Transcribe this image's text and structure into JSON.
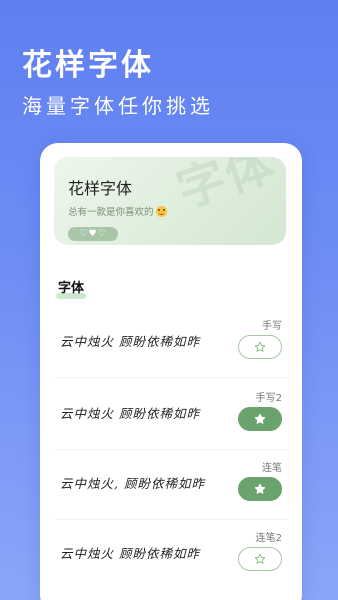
{
  "header": {
    "title": "花样字体",
    "subtitle": "海量字体任你挑选"
  },
  "banner": {
    "title": "花样字体",
    "description": "总有一款是你喜欢的",
    "pill": "♡♥♡",
    "watermark": "字体"
  },
  "section": {
    "tab_label": "字体"
  },
  "fonts": [
    {
      "sample": "云中烛火 顾盼依稀如昨",
      "name": "手写",
      "favorited": false
    },
    {
      "sample": "云中烛火 顾盼依稀如昨",
      "name": "手写2",
      "favorited": true
    },
    {
      "sample": "云中烛火, 顾盼依稀如昨",
      "name": "连笔",
      "favorited": true
    },
    {
      "sample": "云中烛火 顾盼依稀如昨",
      "name": "连笔2",
      "favorited": false
    }
  ],
  "colors": {
    "accent_green": "#6aa36c",
    "header_blue": "#5f7ff0"
  }
}
